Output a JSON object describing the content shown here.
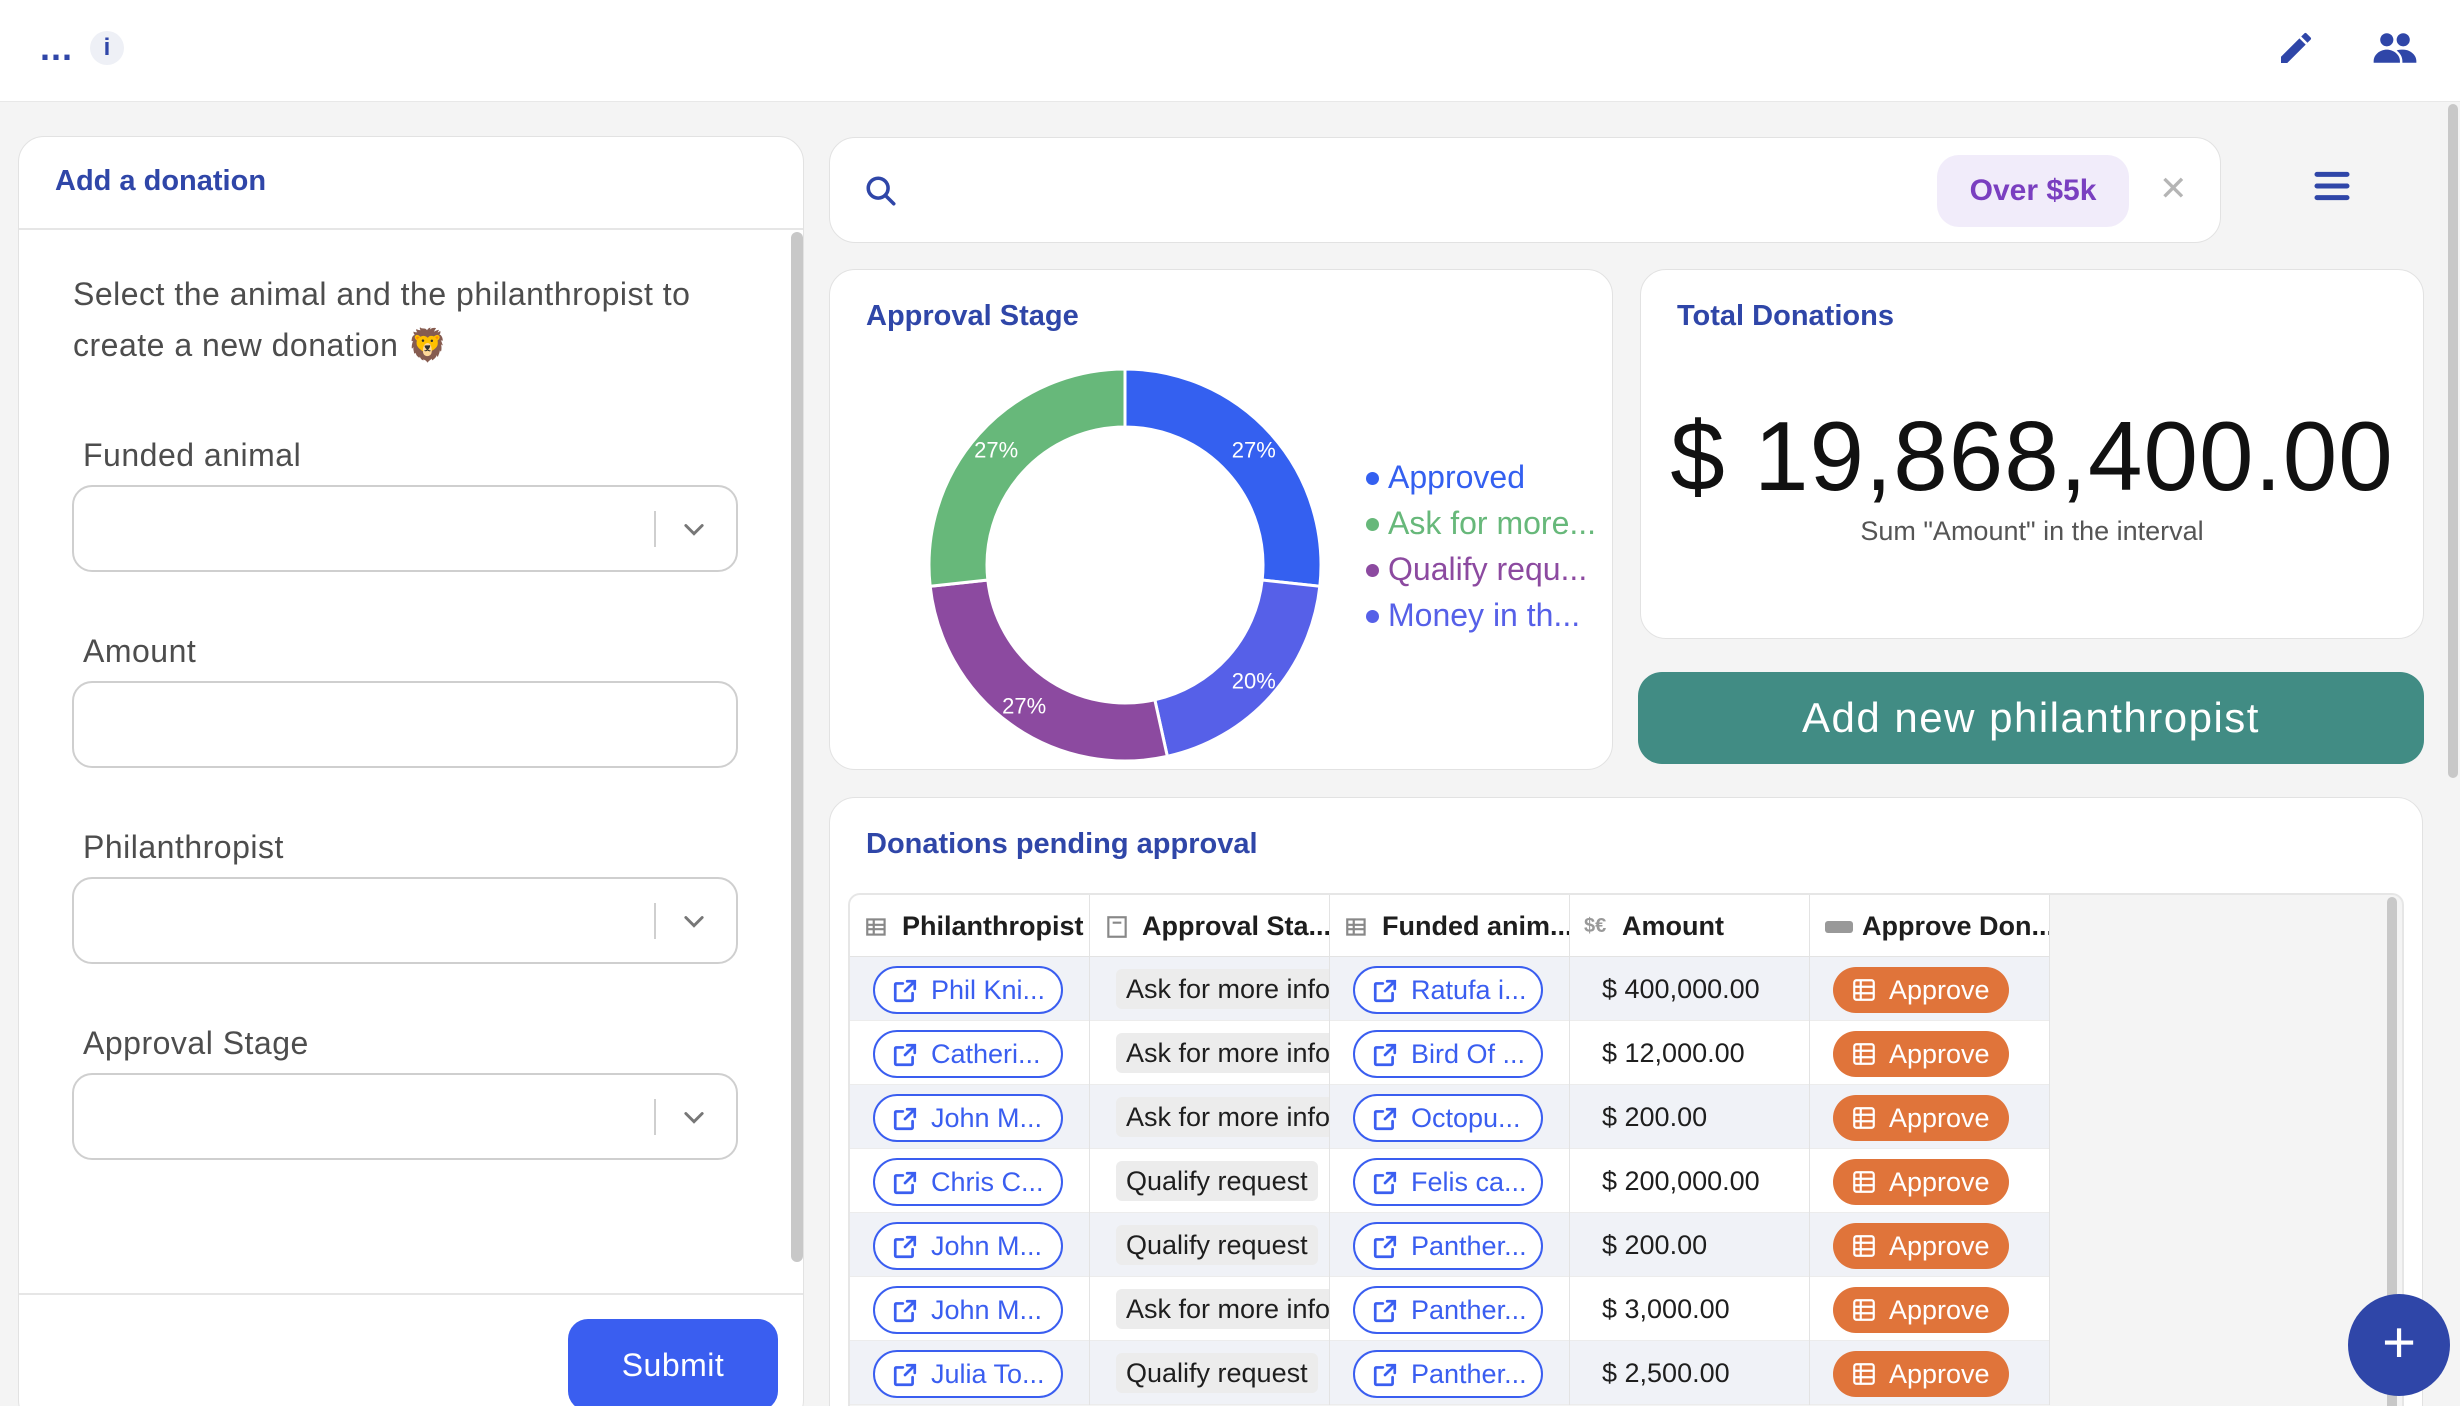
{
  "topbar": {
    "more_label": "...",
    "info_label": "i"
  },
  "left_panel": {
    "title": "Add a donation",
    "intro": "Select the animal and the philanthropist to create a new donation 🦁",
    "fields": [
      {
        "label": "Funded animal",
        "type": "select",
        "value": ""
      },
      {
        "label": "Amount",
        "type": "text",
        "value": ""
      },
      {
        "label": "Philanthropist",
        "type": "select",
        "value": ""
      },
      {
        "label": "Approval Stage",
        "type": "select",
        "value": ""
      }
    ],
    "submit_label": "Submit"
  },
  "search": {
    "value": "",
    "filter_tag": "Over $5k",
    "clear_label": "✕"
  },
  "approval_card": {
    "title": "Approval Stage"
  },
  "chart_data": {
    "type": "pie",
    "title": "Approval Stage",
    "series": [
      {
        "name": "Approved",
        "value": 27,
        "label": "27%",
        "color": "#3460f0"
      },
      {
        "name": "Money in th...",
        "value": 20,
        "label": "20%",
        "color": "#5660e8"
      },
      {
        "name": "Qualify requ...",
        "value": 27,
        "label": "27%",
        "color": "#8c4aa0"
      },
      {
        "name": "Ask for more...",
        "value": 27,
        "label": "27%",
        "color": "#67b87a"
      }
    ],
    "legend_order": [
      "Approved",
      "Ask for more...",
      "Qualify requ...",
      "Money in th..."
    ],
    "legend_position": "right",
    "donut": true
  },
  "total_card": {
    "title": "Total Donations",
    "value": "$ 19,868,400.00",
    "subtitle": "Sum \"Amount\" in the interval"
  },
  "add_button": {
    "label": "Add new philanthropist"
  },
  "table": {
    "title": "Donations pending approval",
    "columns": [
      "Philanthropist",
      "Approval Sta...",
      "Funded anim...",
      "Amount",
      "Approve Don..."
    ],
    "rows": [
      {
        "philanthropist": "Phil Kni...",
        "stage": "Ask for more info",
        "animal": "Ratufa i...",
        "amount": "$ 400,000.00",
        "action": "Approve"
      },
      {
        "philanthropist": "Catheri...",
        "stage": "Ask for more info",
        "animal": "Bird Of ...",
        "amount": "$ 12,000.00",
        "action": "Approve"
      },
      {
        "philanthropist": "John M...",
        "stage": "Ask for more info",
        "animal": "Octopu...",
        "amount": "$ 200.00",
        "action": "Approve"
      },
      {
        "philanthropist": "Chris C...",
        "stage": "Qualify request",
        "animal": "Felis ca...",
        "amount": "$ 200,000.00",
        "action": "Approve"
      },
      {
        "philanthropist": "John M...",
        "stage": "Qualify request",
        "animal": "Panther...",
        "amount": "$ 200.00",
        "action": "Approve"
      },
      {
        "philanthropist": "John M...",
        "stage": "Ask for more info",
        "animal": "Panther...",
        "amount": "$ 3,000.00",
        "action": "Approve"
      },
      {
        "philanthropist": "Julia To...",
        "stage": "Qualify request",
        "animal": "Panther...",
        "amount": "$ 2,500.00",
        "action": "Approve"
      }
    ]
  },
  "fab": {
    "label": "+"
  },
  "icons": {
    "top_left": [
      "more-icon",
      "info-icon"
    ],
    "top_right": [
      "pencil-icon",
      "users-icon"
    ],
    "search": "search-icon",
    "menu": "hamburger-icon"
  }
}
